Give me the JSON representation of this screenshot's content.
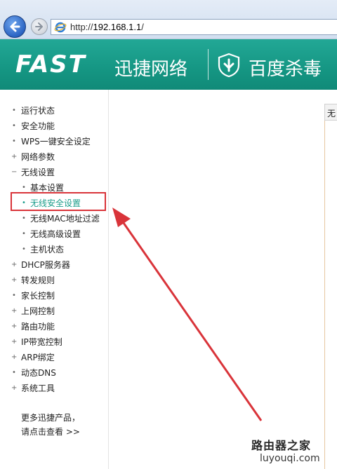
{
  "browser": {
    "back_icon": "back-arrow-icon",
    "forward_icon": "forward-arrow-icon",
    "browser_icon": "ie-icon",
    "url_scheme": "http://",
    "url_host": "192.168.1.1",
    "url_path": "/"
  },
  "header": {
    "brand": "FAST",
    "brand_tagline": "迅捷网络",
    "partner_icon": "shield-icon",
    "partner_text": "百度杀毒",
    "accent_color": "#159683"
  },
  "sidebar": {
    "items": [
      {
        "mark": "•",
        "label": "运行状态",
        "sub": false
      },
      {
        "mark": "•",
        "label": "安全功能",
        "sub": false
      },
      {
        "mark": "•",
        "label": "WPS一键安全设定",
        "sub": false
      },
      {
        "mark": "+",
        "label": "网络参数",
        "sub": false
      },
      {
        "mark": "−",
        "label": "无线设置",
        "sub": false
      },
      {
        "mark": "•",
        "label": "基本设置",
        "sub": true
      },
      {
        "mark": "•",
        "label": "无线安全设置",
        "sub": true,
        "active": true
      },
      {
        "mark": "•",
        "label": "无线MAC地址过滤",
        "sub": true
      },
      {
        "mark": "•",
        "label": "无线高级设置",
        "sub": true
      },
      {
        "mark": "•",
        "label": "主机状态",
        "sub": true
      },
      {
        "mark": "+",
        "label": "DHCP服务器",
        "sub": false
      },
      {
        "mark": "+",
        "label": "转发规则",
        "sub": false
      },
      {
        "mark": "•",
        "label": "家长控制",
        "sub": false
      },
      {
        "mark": "+",
        "label": "上网控制",
        "sub": false
      },
      {
        "mark": "+",
        "label": "路由功能",
        "sub": false
      },
      {
        "mark": "+",
        "label": "IP带宽控制",
        "sub": false
      },
      {
        "mark": "+",
        "label": "ARP绑定",
        "sub": false
      },
      {
        "mark": "•",
        "label": "动态DNS",
        "sub": false
      },
      {
        "mark": "+",
        "label": "系统工具",
        "sub": false
      }
    ],
    "more_line1": "更多迅捷产品，",
    "more_line2": "请点击查看 >>"
  },
  "content": {
    "tab_label": "无"
  },
  "watermark": {
    "text": "路由器之家",
    "url": "luyouqi.com"
  }
}
